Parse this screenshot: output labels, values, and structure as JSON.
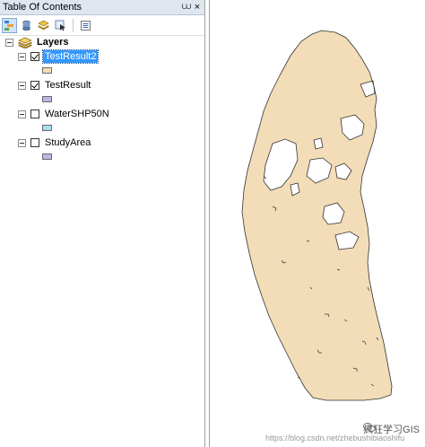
{
  "toc": {
    "title": "Table Of Contents",
    "pin_glyph": "⩊",
    "close_glyph": "×",
    "toolbar": [
      {
        "name": "list-by-drawing-order-icon",
        "active": true
      },
      {
        "name": "list-by-source-icon",
        "active": false
      },
      {
        "name": "list-by-visibility-icon",
        "active": false
      },
      {
        "name": "list-by-selection-icon",
        "active": false
      },
      {
        "name": "options-icon",
        "active": false
      }
    ],
    "root_label": "Layers",
    "layers": [
      {
        "label": "TestResult2",
        "checked": true,
        "selected": true,
        "color": "#f5deb3"
      },
      {
        "label": "TestResult",
        "checked": true,
        "selected": false,
        "color": "#b8b8e6"
      },
      {
        "label": "WaterSHP50N",
        "checked": false,
        "selected": false,
        "color": "#a6dfee"
      },
      {
        "label": "StudyArea",
        "checked": false,
        "selected": false,
        "color": "#b8b8e6"
      }
    ]
  },
  "map": {
    "polygon_fill": "#f3dcb8",
    "polygon_stroke": "#333333"
  },
  "watermark": {
    "brand": "疯狂学习GIS",
    "url": "https://blog.csdn.net/zhebushibiaoshifu"
  }
}
